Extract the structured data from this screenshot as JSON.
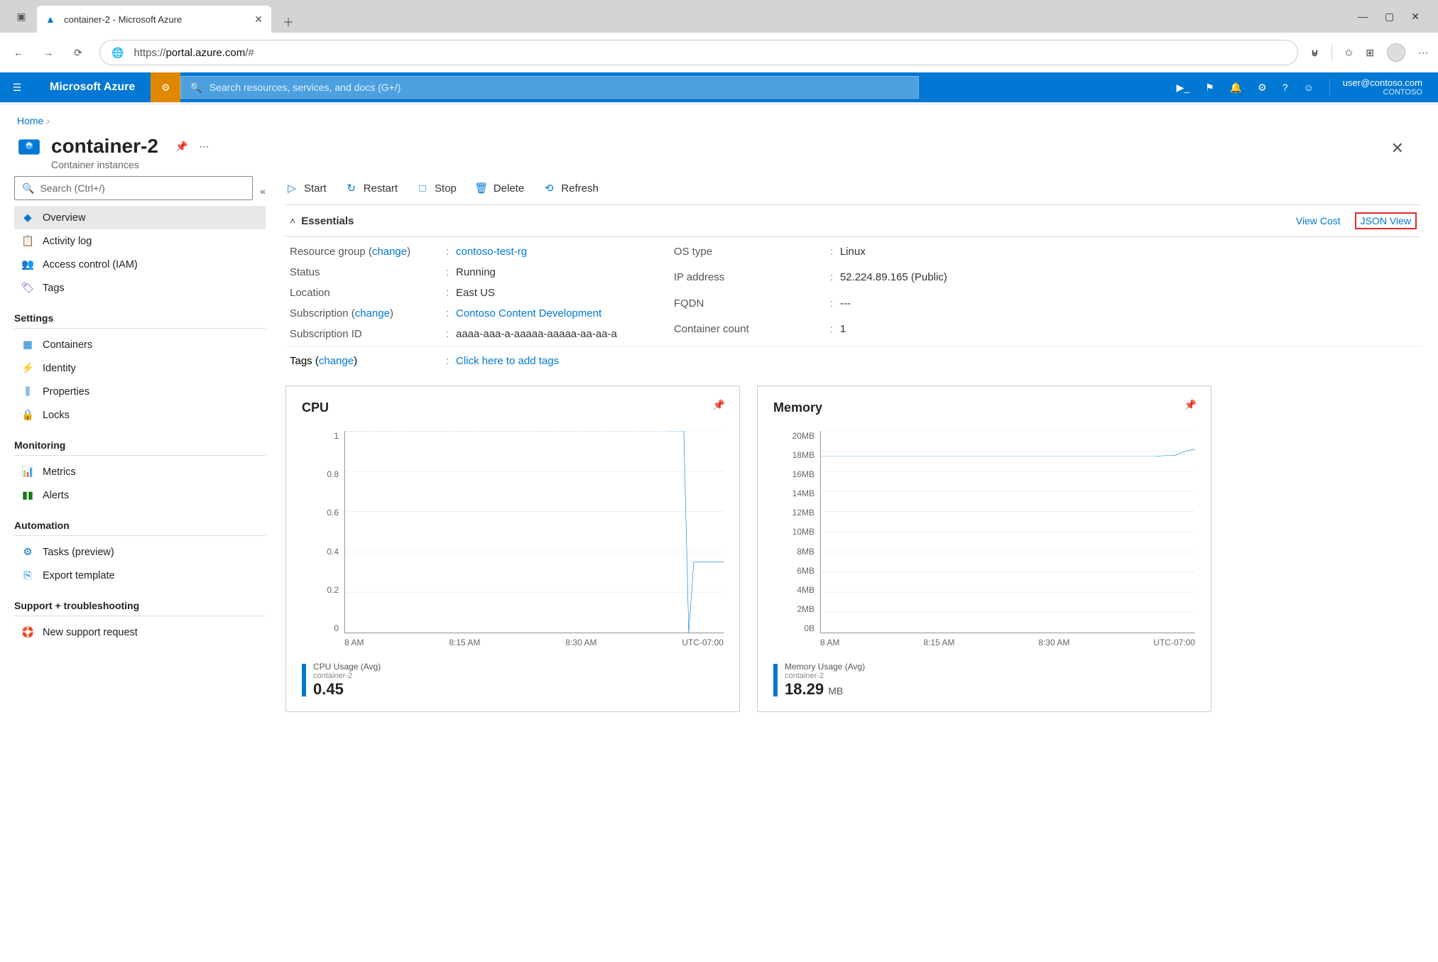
{
  "browser": {
    "tab_title": "container-2 - Microsoft Azure",
    "url_scheme": "https://",
    "url_host": "portal.azure.com",
    "url_path": "/#"
  },
  "azure_header": {
    "brand": "Microsoft Azure",
    "search_placeholder": "Search resources, services, and docs (G+/)",
    "user_email": "user@contoso.com",
    "tenant": "CONTOSO"
  },
  "breadcrumb": {
    "home": "Home"
  },
  "resource": {
    "title": "container-2",
    "subtitle": "Container instances"
  },
  "local_search": {
    "placeholder": "Search (Ctrl+/)"
  },
  "nav": {
    "overview": "Overview",
    "activity": "Activity log",
    "iam": "Access control (IAM)",
    "tags": "Tags",
    "settings_label": "Settings",
    "containers": "Containers",
    "identity": "Identity",
    "properties": "Properties",
    "locks": "Locks",
    "monitoring_label": "Monitoring",
    "metrics": "Metrics",
    "alerts": "Alerts",
    "automation_label": "Automation",
    "tasks": "Tasks (preview)",
    "export": "Export template",
    "support_label": "Support + troubleshooting",
    "new_support": "New support request"
  },
  "commands": {
    "start": "Start",
    "restart": "Restart",
    "stop": "Stop",
    "delete": "Delete",
    "refresh": "Refresh"
  },
  "essentials": {
    "label": "Essentials",
    "view_cost": "View Cost",
    "json_view": "JSON View",
    "rg_label": "Resource group (",
    "change": "change",
    "rg_label2": ")",
    "rg_value": "contoso-test-rg",
    "status_label": "Status",
    "status_value": "Running",
    "location_label": "Location",
    "location_value": "East US",
    "sub_label": "Subscription (",
    "sub_value": "Contoso Content Development",
    "subid_label": "Subscription ID",
    "subid_value": "aaaa-aaa-a-aaaaa-aaaaa-aa-aa-a",
    "os_label": "OS type",
    "os_value": "Linux",
    "ip_label": "IP address",
    "ip_value": "52.224.89.165 (Public)",
    "fqdn_label": "FQDN",
    "fqdn_value": "---",
    "count_label": "Container count",
    "count_value": "1",
    "tags_label": "Tags (",
    "tags_cta": "Click here to add tags"
  },
  "chart_data": [
    {
      "type": "line",
      "title": "CPU",
      "metric_label": "CPU Usage (Avg)",
      "series_name": "container-2",
      "display_value": "0.45",
      "y_ticks": [
        "1",
        "0.8",
        "0.6",
        "0.4",
        "0.2",
        "0"
      ],
      "x_ticks": [
        "8 AM",
        "8:15 AM",
        "8:30 AM",
        "UTC-07:00"
      ],
      "ylim": [
        0,
        1
      ],
      "x": [
        0,
        5,
        10,
        15,
        20,
        25,
        30,
        35,
        40,
        45,
        50,
        55,
        60,
        65,
        68,
        69,
        70,
        71,
        76
      ],
      "values": [
        1,
        1,
        1,
        1,
        1,
        1,
        1,
        1,
        1,
        1,
        1,
        1,
        1,
        1,
        1,
        0,
        0.35,
        0.35,
        0.35
      ]
    },
    {
      "type": "line",
      "title": "Memory",
      "metric_label": "Memory Usage (Avg)",
      "series_name": "container-2",
      "display_value": "18.29",
      "display_unit": "MB",
      "y_ticks": [
        "20MB",
        "18MB",
        "16MB",
        "14MB",
        "12MB",
        "10MB",
        "8MB",
        "6MB",
        "4MB",
        "2MB",
        "0B"
      ],
      "x_ticks": [
        "8 AM",
        "8:15 AM",
        "8:30 AM",
        "UTC-07:00"
      ],
      "ylim": [
        0,
        20
      ],
      "x": [
        0,
        10,
        20,
        30,
        40,
        50,
        60,
        68,
        72,
        74,
        76
      ],
      "values": [
        17.5,
        17.5,
        17.5,
        17.5,
        17.5,
        17.5,
        17.5,
        17.5,
        17.6,
        18.0,
        18.2
      ]
    }
  ]
}
